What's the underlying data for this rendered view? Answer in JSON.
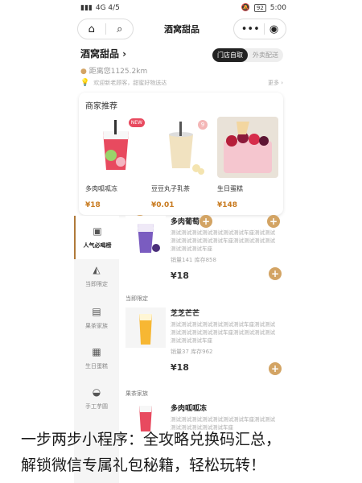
{
  "status": {
    "left_text": "4G 4/5",
    "time": "5:00",
    "battery": "92"
  },
  "nav": {
    "title": "酒窝甜品",
    "home_icon": "home-icon",
    "search_icon": "search-icon",
    "more_icon": "more-dots-icon",
    "target_icon": "target-icon"
  },
  "store": {
    "name": "酒窝甜品 ›",
    "distance": "距离您1125.2km",
    "mode_active": "门店自取",
    "mode_inactive": "外卖配送"
  },
  "notice": {
    "text": "欢迎新老顾客，甜蜜好物送达",
    "more": "更多 ›"
  },
  "recommend": {
    "title": "商家推荐",
    "items": [
      {
        "name": "多肉呱呱冻",
        "price": "¥18",
        "badge": "NEW"
      },
      {
        "name": "豆豆丸子乳茶",
        "price": "¥0.01",
        "badge": "9"
      },
      {
        "name": "生日蛋糕",
        "price": "¥148",
        "badge": ""
      }
    ]
  },
  "sidebar": {
    "items": [
      {
        "label": "人气必喝榜"
      },
      {
        "label": "当即限定"
      },
      {
        "label": "果茶家族"
      },
      {
        "label": "生日蛋糕"
      },
      {
        "label": "手工芋圆"
      }
    ]
  },
  "products": {
    "p1": {
      "name": "多肉葡萄",
      "desc": "测试测试测试测试测试测试测试车座测试测试测试测试测试测试测试车座测试测试测试测试测试测试测试车座",
      "stock": "销量141   库存858",
      "price": "¥18"
    },
    "section2": "当即限定",
    "p2": {
      "name": "芝芝芒芒",
      "desc": "测试测试测试测试测试测试测试车座测试测试测试测试测试测试测试车座测试测试测试测试测试测试测试车座",
      "stock": "销量37   库存962",
      "price": "¥18"
    },
    "section3": "果茶家族",
    "p3": {
      "name": "多肉呱呱冻",
      "desc": "测试测试测试测试测试测试测试车座测试测试测试测试测试测试测试车座"
    }
  },
  "overlay": {
    "line1": "一步两步小程序：全攻略兑换码汇总，",
    "line2": "解锁微信专属礼包秘籍，轻松玩转！"
  },
  "colors": {
    "accent": "#d3a464",
    "price": "#c87a1f",
    "dark": "#222222"
  }
}
